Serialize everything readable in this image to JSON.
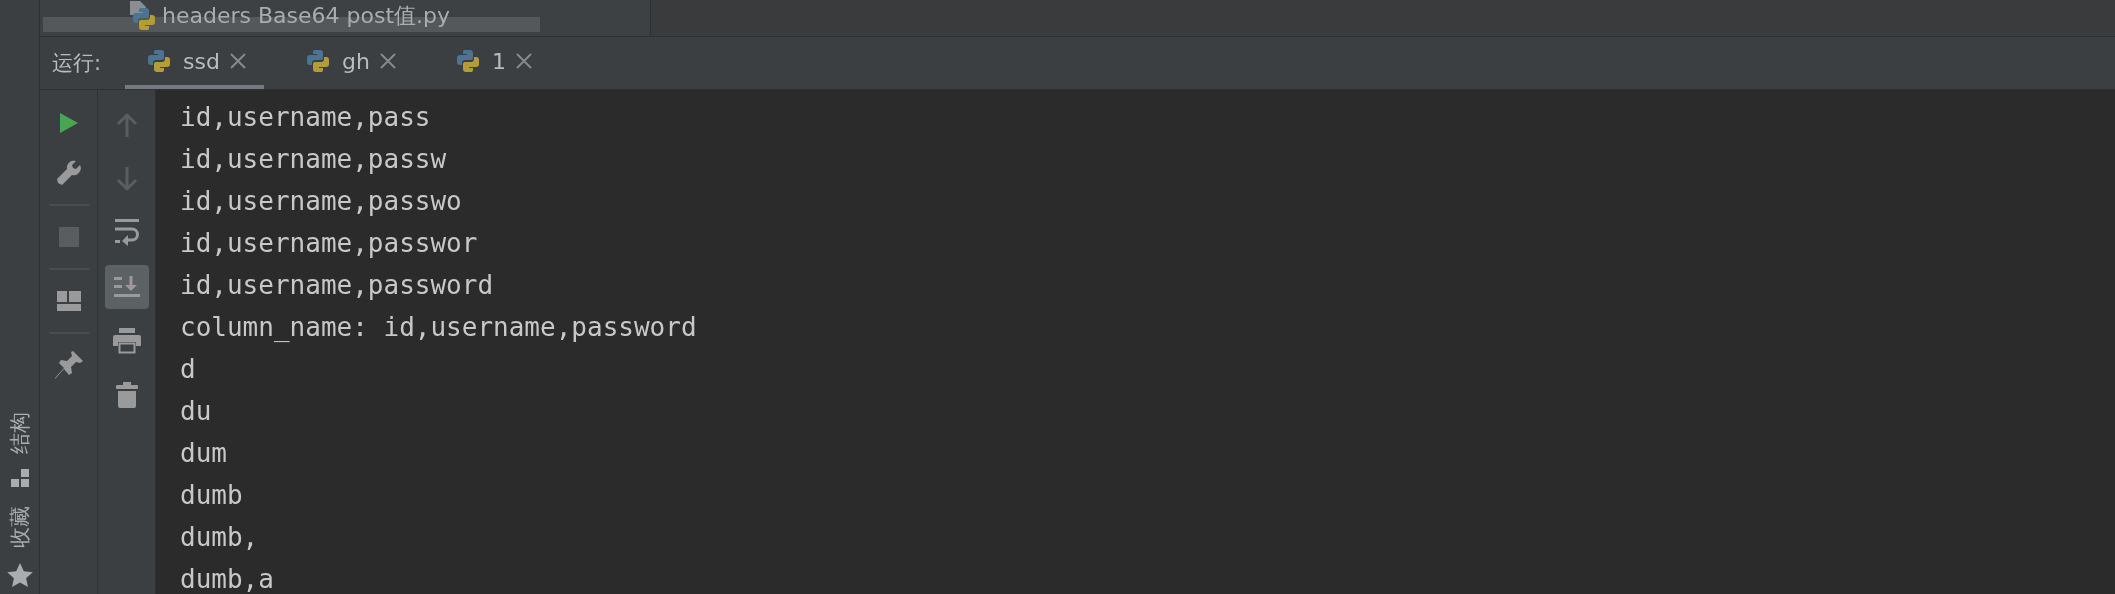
{
  "file_tab": {
    "label": "headers Base64 post值.py"
  },
  "side_labels": [
    {
      "label": "结构",
      "kind": "structure"
    },
    {
      "label": "收藏",
      "kind": "favorites"
    }
  ],
  "run_bar": {
    "label": "运行:",
    "tabs": [
      {
        "label": "ssd",
        "selected": true
      },
      {
        "label": "gh",
        "selected": false
      },
      {
        "label": "1",
        "selected": false
      }
    ]
  },
  "toolbar_left": [
    {
      "kind": "run",
      "disabled": false
    },
    {
      "kind": "wrench",
      "disabled": false
    },
    {
      "kind": "separator"
    },
    {
      "kind": "stop",
      "disabled": true
    },
    {
      "kind": "separator"
    },
    {
      "kind": "layout",
      "disabled": false
    },
    {
      "kind": "separator"
    },
    {
      "kind": "pin",
      "disabled": false
    }
  ],
  "toolbar_right": [
    {
      "kind": "up",
      "disabled": true
    },
    {
      "kind": "down",
      "disabled": true
    },
    {
      "kind": "wrap",
      "on": false
    },
    {
      "kind": "scroll-end",
      "on": true
    },
    {
      "kind": "print",
      "disabled": false
    },
    {
      "kind": "trash",
      "disabled": false
    }
  ],
  "console": [
    "id,username,pass",
    "id,username,passw",
    "id,username,passwo",
    "id,username,passwor",
    "id,username,password",
    "column_name: id,username,password",
    "d",
    "du",
    "dum",
    "dumb",
    "dumb,",
    "dumb,a"
  ]
}
